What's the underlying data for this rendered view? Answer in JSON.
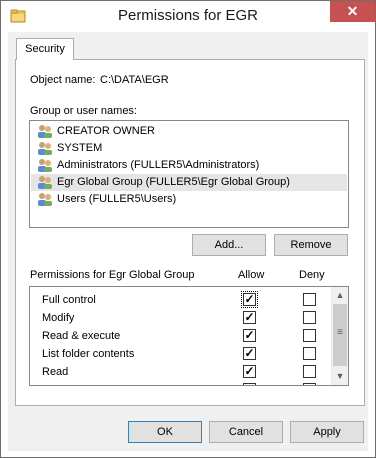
{
  "window": {
    "title": "Permissions for EGR",
    "folder_icon": "folder-icon",
    "close_glyph": "✕"
  },
  "tabs": [
    {
      "label": "Security"
    }
  ],
  "object": {
    "label": "Object name:",
    "value": "C:\\DATA\\EGR"
  },
  "groups": {
    "label": "Group or user names:",
    "items": [
      {
        "name": "CREATOR OWNER",
        "icon": "users-icon"
      },
      {
        "name": "SYSTEM",
        "icon": "users-icon"
      },
      {
        "name": "Administrators (FULLER5\\Administrators)",
        "icon": "users-icon"
      },
      {
        "name": "Egr Global Group (FULLER5\\Egr Global Group)",
        "icon": "users-icon",
        "selected": true
      },
      {
        "name": "Users (FULLER5\\Users)",
        "icon": "users-icon"
      }
    ],
    "add_label": "Add...",
    "remove_label": "Remove"
  },
  "permissions": {
    "header": "Permissions for Egr Global Group",
    "allow_header": "Allow",
    "deny_header": "Deny",
    "rows": [
      {
        "name": "Full control",
        "allow": true,
        "deny": false
      },
      {
        "name": "Modify",
        "allow": true,
        "deny": false
      },
      {
        "name": "Read & execute",
        "allow": true,
        "deny": false
      },
      {
        "name": "List folder contents",
        "allow": true,
        "deny": false
      },
      {
        "name": "Read",
        "allow": true,
        "deny": false
      }
    ],
    "check_glyph": "✓"
  },
  "footer": {
    "ok_label": "OK",
    "cancel_label": "Cancel",
    "apply_label": "Apply"
  },
  "colors": {
    "close_button": "#c75050",
    "selected_row": "#e5e5e5",
    "dialog_bg": "#f0f0f0"
  }
}
